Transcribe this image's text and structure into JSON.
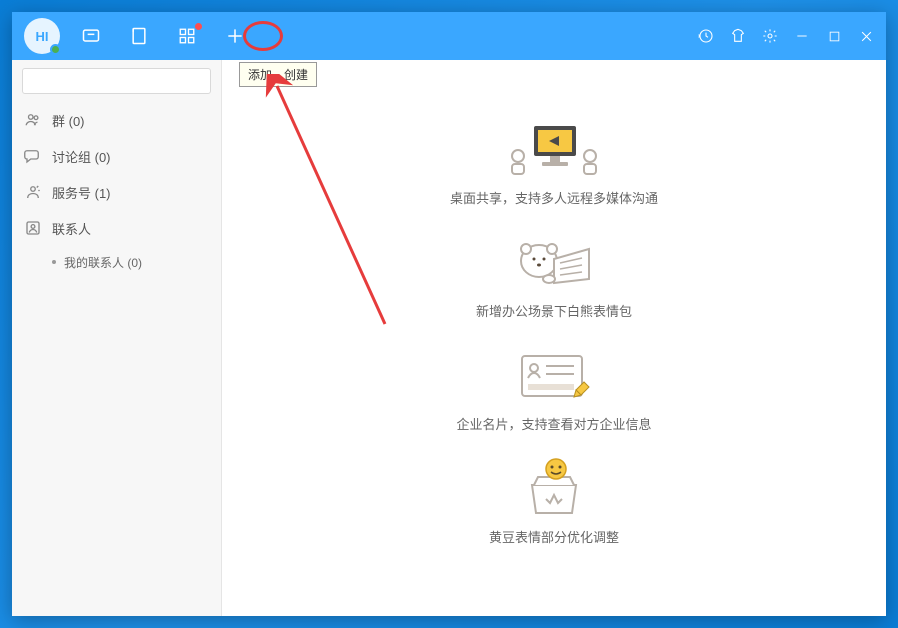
{
  "logo": {
    "text": "HI"
  },
  "tooltip": "添加，创建",
  "search": {
    "placeholder": ""
  },
  "sidebar": {
    "items": [
      {
        "label": "群 (0)"
      },
      {
        "label": "讨论组 (0)"
      },
      {
        "label": "服务号 (1)"
      },
      {
        "label": "联系人"
      }
    ],
    "sub": [
      {
        "label": "我的联系人 (0)"
      }
    ]
  },
  "features": [
    {
      "caption": "桌面共享，支持多人远程多媒体沟通"
    },
    {
      "caption": "新增办公场景下白熊表情包"
    },
    {
      "caption": "企业名片，支持查看对方企业信息"
    },
    {
      "caption": "黄豆表情部分优化调整"
    }
  ]
}
